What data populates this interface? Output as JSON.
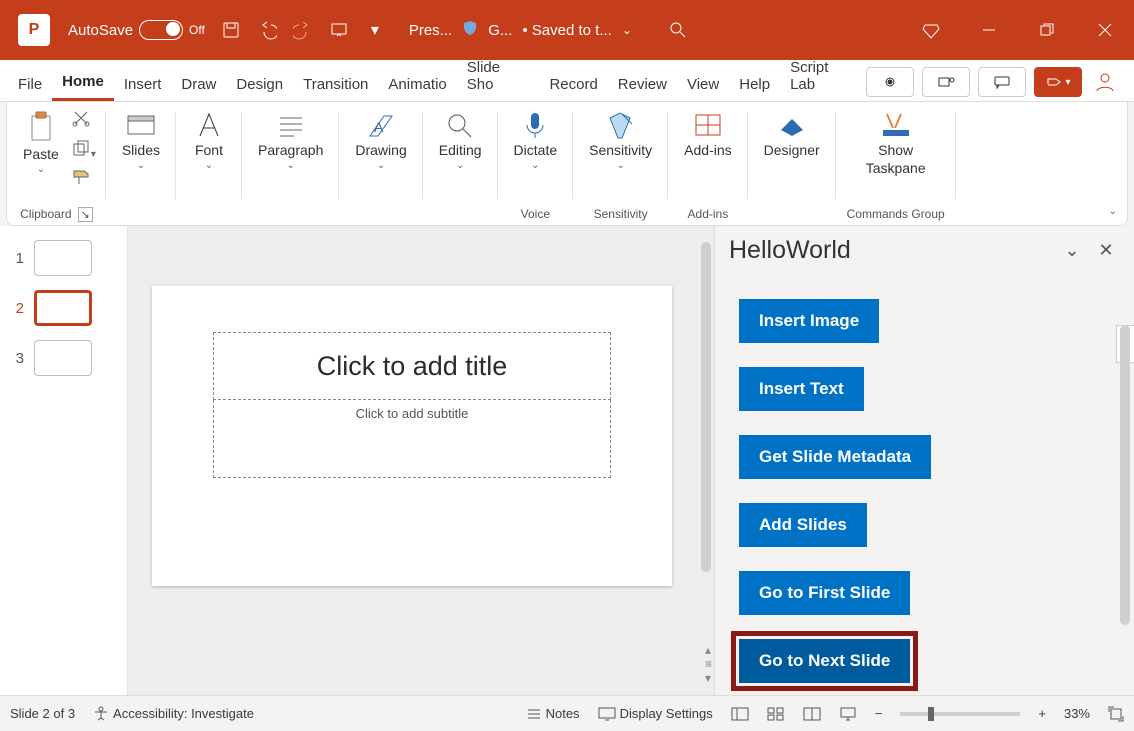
{
  "titlebar": {
    "autosave_label": "AutoSave",
    "autosave_state": "Off",
    "doc_short": "Pres...",
    "shield_text": "G...",
    "save_status": "• Saved to t..."
  },
  "tabs": {
    "file": "File",
    "home": "Home",
    "insert": "Insert",
    "draw": "Draw",
    "design": "Design",
    "transitions": "Transition",
    "animations": "Animatio",
    "slideshow": "Slide Sho",
    "record": "Record",
    "review": "Review",
    "view": "View",
    "help": "Help",
    "scriptlab": "Script Lab"
  },
  "ribbon": {
    "clipboard_label": "Clipboard",
    "paste": "Paste",
    "slides": "Slides",
    "font": "Font",
    "paragraph": "Paragraph",
    "drawing": "Drawing",
    "editing": "Editing",
    "dictate": "Dictate",
    "voice_label": "Voice",
    "sensitivity": "Sensitivity",
    "sensitivity_label": "Sensitivity",
    "addins": "Add-ins",
    "addins_label": "Add-ins",
    "designer": "Designer",
    "show_taskpane_l1": "Show",
    "show_taskpane_l2": "Taskpane",
    "commands_label": "Commands Group"
  },
  "thumbnails": {
    "n1": "1",
    "n2": "2",
    "n3": "3"
  },
  "slide": {
    "title_placeholder": "Click to add title",
    "subtitle_placeholder": "Click to add subtitle"
  },
  "taskpane": {
    "title": "HelloWorld",
    "btn_insert_image": "Insert Image",
    "btn_insert_text": "Insert Text",
    "btn_get_metadata": "Get Slide Metadata",
    "btn_add_slides": "Add Slides",
    "btn_goto_first": "Go to First Slide",
    "btn_goto_next": "Go to Next Slide"
  },
  "statusbar": {
    "slide_count": "Slide 2 of 3",
    "accessibility": "Accessibility: Investigate",
    "notes": "Notes",
    "display_settings": "Display Settings",
    "zoom": "33%"
  }
}
